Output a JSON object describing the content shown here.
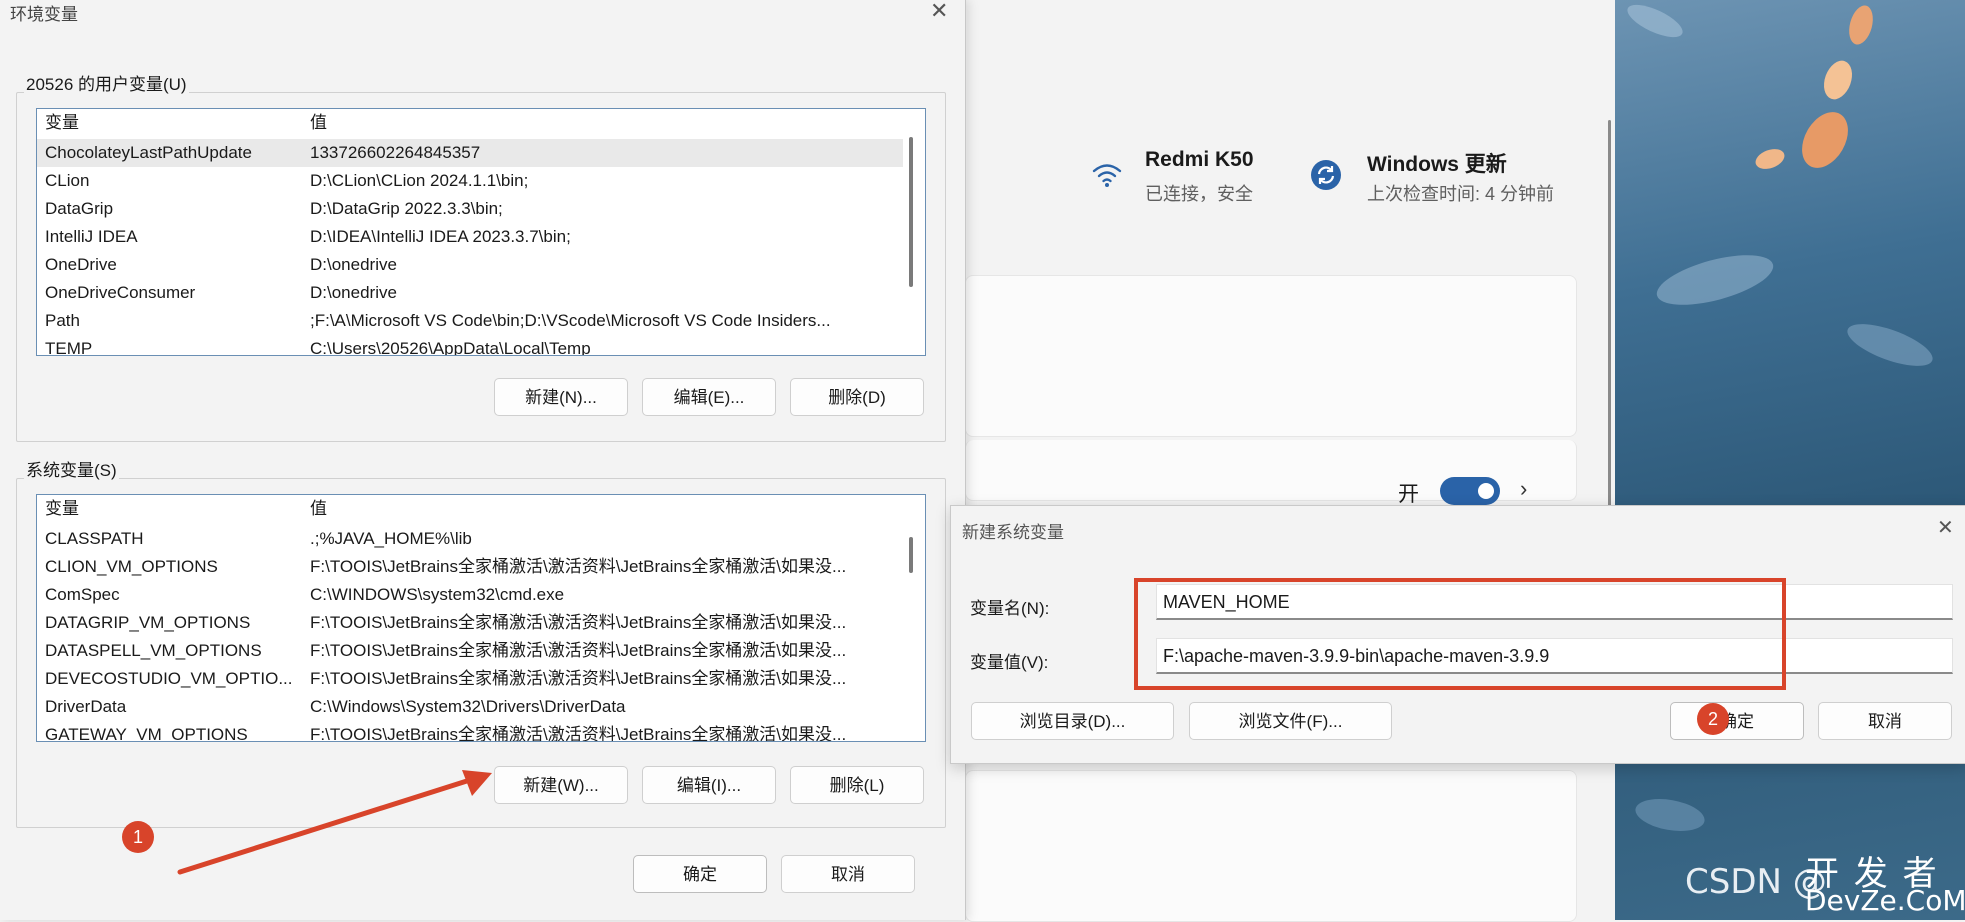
{
  "settings": {
    "wifi": {
      "title": "Redmi K50",
      "subtitle": "已连接，安全"
    },
    "update": {
      "title": "Windows 更新",
      "subtitle": "上次检查时间: 4 分钟前"
    },
    "toggle_label": "开",
    "toggle_on": true
  },
  "env_dialog": {
    "title": "环境变量",
    "user_group_label": "20526 的用户变量(U)",
    "system_group_label": "系统变量(S)",
    "col_name": "变量",
    "col_value": "值",
    "user_vars": [
      {
        "name": "ChocolateyLastPathUpdate",
        "value": "133726602264845357"
      },
      {
        "name": "CLion",
        "value": "D:\\CLion\\CLion 2024.1.1\\bin;"
      },
      {
        "name": "DataGrip",
        "value": "D:\\DataGrip 2022.3.3\\bin;"
      },
      {
        "name": "IntelliJ IDEA",
        "value": "D:\\IDEA\\IntelliJ IDEA 2023.3.7\\bin;"
      },
      {
        "name": "OneDrive",
        "value": "D:\\onedrive"
      },
      {
        "name": "OneDriveConsumer",
        "value": "D:\\onedrive"
      },
      {
        "name": "Path",
        "value": ";F:\\A\\Microsoft VS Code\\bin;D:\\VScode\\Microsoft VS Code Insiders..."
      },
      {
        "name": "TEMP",
        "value": "C:\\Users\\20526\\AppData\\Local\\Temp"
      }
    ],
    "system_vars": [
      {
        "name": "CLASSPATH",
        "value": ".;%JAVA_HOME%\\lib"
      },
      {
        "name": "CLION_VM_OPTIONS",
        "value": "F:\\TOOIS\\JetBrains全家桶激活\\激活资料\\JetBrains全家桶激活\\如果没..."
      },
      {
        "name": "ComSpec",
        "value": "C:\\WINDOWS\\system32\\cmd.exe"
      },
      {
        "name": "DATAGRIP_VM_OPTIONS",
        "value": "F:\\TOOIS\\JetBrains全家桶激活\\激活资料\\JetBrains全家桶激活\\如果没..."
      },
      {
        "name": "DATASPELL_VM_OPTIONS",
        "value": "F:\\TOOIS\\JetBrains全家桶激活\\激活资料\\JetBrains全家桶激活\\如果没..."
      },
      {
        "name": "DEVECOSTUDIO_VM_OPTIO...",
        "value": "F:\\TOOIS\\JetBrains全家桶激活\\激活资料\\JetBrains全家桶激活\\如果没..."
      },
      {
        "name": "DriverData",
        "value": "C:\\Windows\\System32\\Drivers\\DriverData"
      },
      {
        "name": "GATEWAY_VM_OPTIONS",
        "value": "F:\\TOOIS\\JetBrains全家桶激活\\激活资料\\JetBrains全家桶激活\\如果没..."
      }
    ],
    "user_buttons": {
      "new": "新建(N)...",
      "edit": "编辑(E)...",
      "delete": "删除(D)"
    },
    "system_buttons": {
      "new": "新建(W)...",
      "edit": "编辑(I)...",
      "delete": "删除(L)"
    },
    "ok": "确定",
    "cancel": "取消"
  },
  "new_var_dialog": {
    "title": "新建系统变量",
    "name_label": "变量名(N):",
    "name_value": "MAVEN_HOME",
    "value_label": "变量值(V):",
    "value_value": "F:\\apache-maven-3.9.9-bin\\apache-maven-3.9.9",
    "browse_dir": "浏览目录(D)...",
    "browse_file": "浏览文件(F)...",
    "ok": "确定",
    "cancel": "取消"
  },
  "annotations": {
    "step1": "1",
    "step2": "2",
    "accent": "#d8442a"
  },
  "watermark": {
    "left": "CSDN @",
    "right_top": "开 发 者",
    "right_bottom": "DevZe.CoM"
  }
}
